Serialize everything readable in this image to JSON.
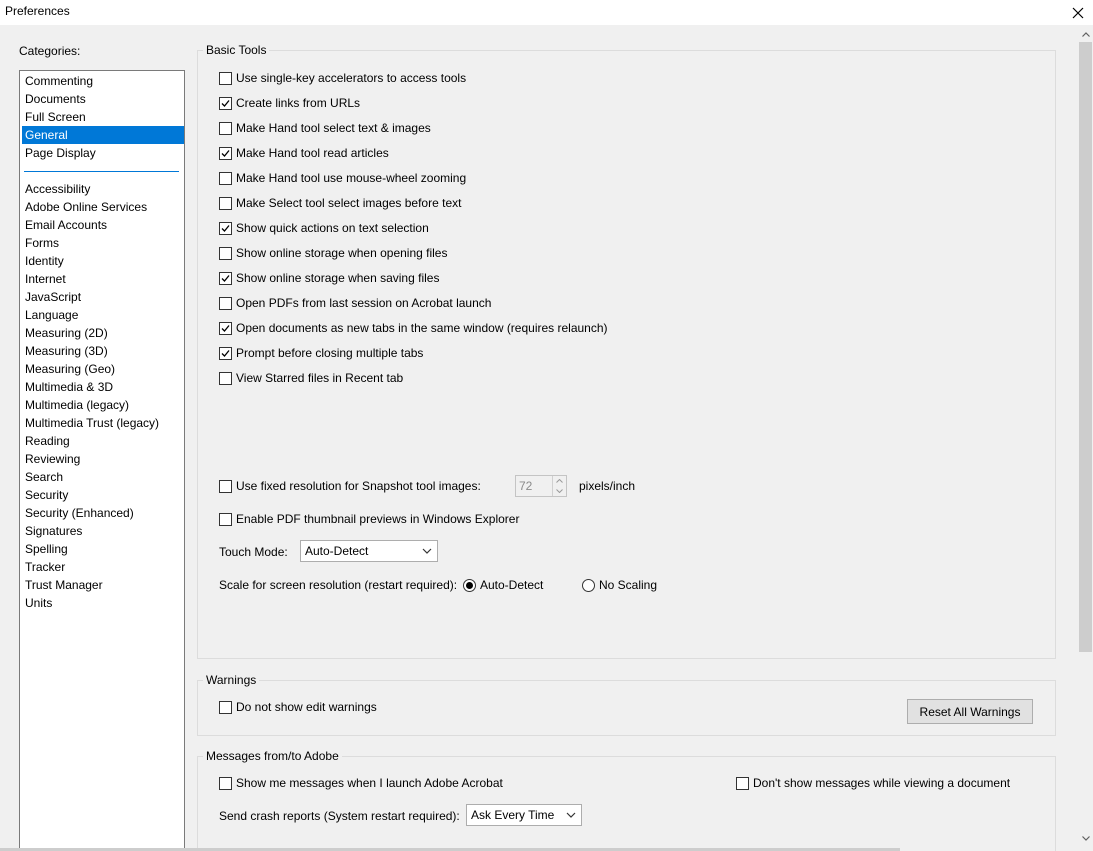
{
  "window": {
    "title": "Preferences"
  },
  "categories": {
    "label": "Categories:",
    "top_items": [
      "Commenting",
      "Documents",
      "Full Screen",
      "General",
      "Page Display"
    ],
    "selected": "General",
    "items": [
      "Accessibility",
      "Adobe Online Services",
      "Email Accounts",
      "Forms",
      "Identity",
      "Internet",
      "JavaScript",
      "Language",
      "Measuring (2D)",
      "Measuring (3D)",
      "Measuring (Geo)",
      "Multimedia & 3D",
      "Multimedia (legacy)",
      "Multimedia Trust (legacy)",
      "Reading",
      "Reviewing",
      "Search",
      "Security",
      "Security (Enhanced)",
      "Signatures",
      "Spelling",
      "Tracker",
      "Trust Manager",
      "Units"
    ]
  },
  "basic_tools": {
    "label": "Basic Tools",
    "options": [
      {
        "label": "Use single-key accelerators to access tools",
        "checked": false
      },
      {
        "label": "Create links from URLs",
        "checked": true
      },
      {
        "label": "Make Hand tool select text & images",
        "checked": false
      },
      {
        "label": "Make Hand tool read articles",
        "checked": true
      },
      {
        "label": "Make Hand tool use mouse-wheel zooming",
        "checked": false
      },
      {
        "label": "Make Select tool select images before text",
        "checked": false
      },
      {
        "label": "Show quick actions on text selection",
        "checked": true
      },
      {
        "label": "Show online storage when opening files",
        "checked": false
      },
      {
        "label": "Show online storage when saving files",
        "checked": true
      },
      {
        "label": "Open PDFs from last session on Acrobat launch",
        "checked": false
      },
      {
        "label": "Open documents as new tabs in the same window (requires relaunch)",
        "checked": true
      },
      {
        "label": "Prompt before closing multiple tabs",
        "checked": true
      },
      {
        "label": "View Starred files in Recent tab",
        "checked": false
      }
    ],
    "snapshot": {
      "label": "Use fixed resolution for Snapshot tool images:",
      "checked": false,
      "value": "72",
      "unit": "pixels/inch"
    },
    "thumbnail": {
      "label": "Enable PDF thumbnail previews in Windows Explorer",
      "checked": false
    },
    "touch_mode": {
      "label": "Touch Mode:",
      "value": "Auto-Detect"
    },
    "scale": {
      "label": "Scale for screen resolution (restart required):",
      "option1": "Auto-Detect",
      "option2": "No Scaling",
      "selected": "Auto-Detect"
    }
  },
  "warnings": {
    "label": "Warnings",
    "edit_warnings": {
      "label": "Do not show edit warnings",
      "checked": false
    },
    "reset_button": "Reset All Warnings"
  },
  "messages": {
    "label": "Messages from/to Adobe",
    "launch_messages": {
      "label": "Show me messages when I launch Adobe Acrobat",
      "checked": false
    },
    "dont_show": {
      "label": "Don't show messages while viewing a document",
      "checked": false
    },
    "crash_reports": {
      "label": "Send crash reports (System restart required):",
      "value": "Ask Every Time"
    }
  }
}
